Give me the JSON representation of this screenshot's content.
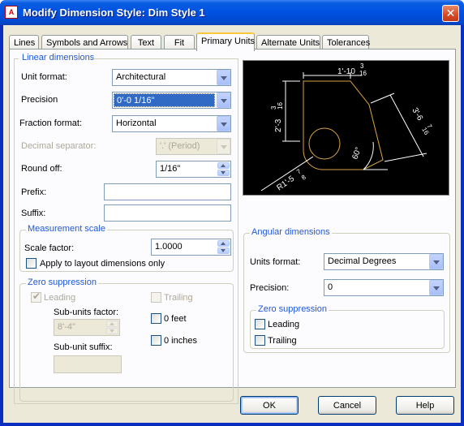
{
  "window": {
    "title": "Modify Dimension Style: Dim Style 1",
    "app_icon": "A",
    "close": "✕"
  },
  "tabs": [
    "Lines",
    "Symbols and Arrows",
    "Text",
    "Fit",
    "Primary Units",
    "Alternate Units",
    "Tolerances"
  ],
  "linear": {
    "legend": "Linear dimensions",
    "unit_format_label": "Unit format:",
    "unit_format": "Architectural",
    "precision_label": "Precision",
    "precision": "0'-0 1/16\"",
    "fraction_format_label": "Fraction format:",
    "fraction_format": "Horizontal",
    "decimal_sep_label": "Decimal separator:",
    "decimal_sep": "'.' (Period)",
    "round_off_label": "Round off:",
    "round_off": "1/16\"",
    "prefix_label": "Prefix:",
    "prefix": "",
    "suffix_label": "Suffix:",
    "suffix": ""
  },
  "measurement": {
    "legend": "Measurement scale",
    "scale_factor_label": "Scale factor:",
    "scale_factor": "1.0000",
    "apply_layout_label": "Apply to layout dimensions only"
  },
  "zero_linear": {
    "legend": "Zero suppression",
    "leading": "Leading",
    "trailing": "Trailing",
    "sub_units_factor_label": "Sub-units factor:",
    "sub_units_factor": "8'-4\"",
    "zero_feet": "0 feet",
    "zero_inches": "0 inches",
    "sub_unit_suffix_label": "Sub-unit suffix:",
    "sub_unit_suffix": ""
  },
  "angular": {
    "legend": "Angular dimensions",
    "units_format_label": "Units format:",
    "units_format": "Decimal Degrees",
    "precision_label": "Precision:",
    "precision": "0"
  },
  "zero_angular": {
    "legend": "Zero suppression",
    "leading": "Leading",
    "trailing": "Trailing"
  },
  "preview": {
    "dim_top": "1'-10",
    "dim_top_frac_num": "3",
    "dim_top_frac_den": "16",
    "dim_left": "2'-3",
    "dim_left_frac_num": "3",
    "dim_left_frac_den": "16",
    "dim_right": "3'-6",
    "dim_right_frac_num": "7",
    "dim_right_frac_den": "16",
    "dim_radius": "R1'-5",
    "dim_radius_frac_num": "7",
    "dim_radius_frac_den": "8",
    "angle": "60°"
  },
  "buttons": {
    "ok": "OK",
    "cancel": "Cancel",
    "help": "Help"
  }
}
